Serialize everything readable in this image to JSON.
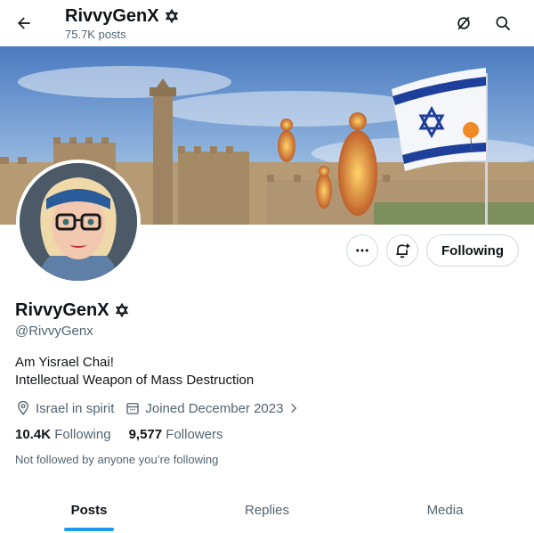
{
  "header": {
    "title": "RivvyGenX",
    "post_count": "75.7K posts",
    "back_icon": "arrow-left-icon",
    "verified_icon": "star-of-david-icon"
  },
  "profile": {
    "name": "RivvyGenX",
    "handle": "@RivvyGenx",
    "bio_line1": "Am Yisrael Chai!",
    "bio_line2": "Intellectual Weapon of Mass Destruction",
    "location": "Israel in spirit",
    "joined": "Joined December 2023",
    "following_count": "10.4K",
    "following_label": "Following",
    "followers_count": "9,577",
    "followers_label": "Followers",
    "not_followed": "Not followed by anyone you’re following"
  },
  "actions": {
    "more_icon": "more-horizontal-icon",
    "notify_icon": "bell-plus-icon",
    "following_button": "Following"
  },
  "tabs": [
    {
      "label": "Posts",
      "active": true
    },
    {
      "label": "Replies",
      "active": false
    },
    {
      "label": "Media",
      "active": false
    }
  ],
  "colors": {
    "accent": "#1d9bf0",
    "text_primary": "#0f1419",
    "text_secondary": "#536471",
    "border": "#cfd9de"
  }
}
